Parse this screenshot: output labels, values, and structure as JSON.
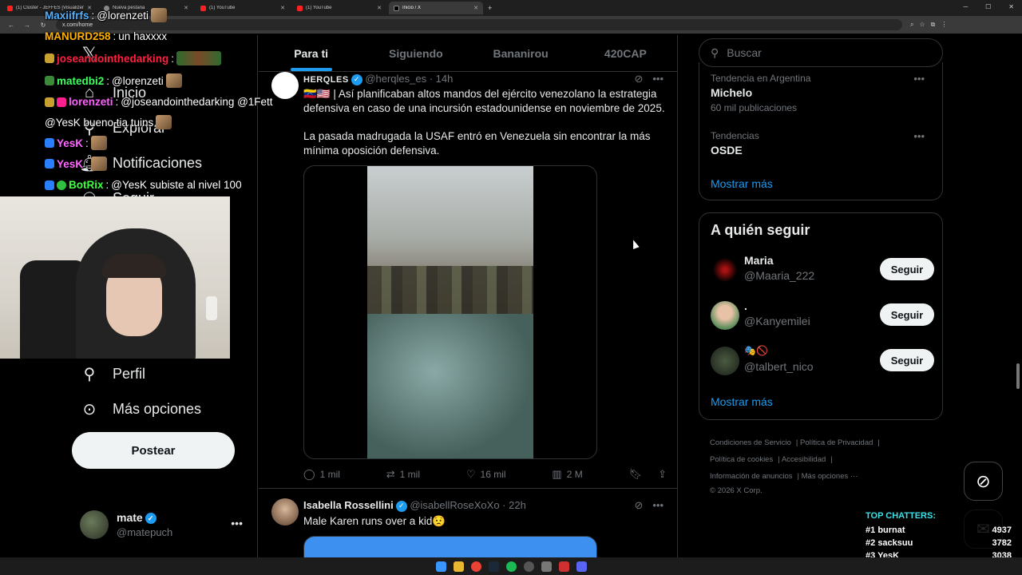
{
  "browser": {
    "tabs": [
      {
        "title": "(1) Clúster - JEFFES [Visualizer",
        "favicon": "youtube-icon",
        "active": false
      },
      {
        "title": "Nueva pestaña",
        "favicon": "chrome-icon",
        "active": false
      },
      {
        "title": "(1) YouTube",
        "favicon": "youtube-icon",
        "active": false
      },
      {
        "title": "(1) YouTube",
        "favicon": "youtube-icon",
        "active": false
      },
      {
        "title": "Inicio / X",
        "favicon": "x-icon",
        "active": true
      }
    ],
    "url": "x.com/home"
  },
  "chat_overlay": [
    {
      "user": "Maxiifrfs",
      "user_color": "#4fb0ff",
      "message": "@lorenzeti"
    },
    {
      "user": "MANURD258",
      "user_color": "#ffb000",
      "message": "un haxxxx"
    },
    {
      "user": "joseandointhedarking",
      "user_color": "#ff2040",
      "message": ""
    },
    {
      "user": "matedbi2",
      "user_color": "#40ff60",
      "message": "@lorenzeti"
    },
    {
      "user": "lorenzeti",
      "user_color": "#ff60ff",
      "message": "@joseandointhedarking @1Fett"
    },
    {
      "user": "",
      "user_color": "#ffffff",
      "message": "@YesK bueno tia tuins"
    },
    {
      "user": "YesK",
      "user_color": "#ff66ff",
      "message": ""
    },
    {
      "user": "YesK",
      "user_color": "#ff66ff",
      "message": ""
    },
    {
      "user": "BotRix",
      "user_color": "#40ff40",
      "message": "@YesK subiste al nivel 100"
    }
  ],
  "left_nav": {
    "items": [
      {
        "label": "Inicio",
        "icon": "home-icon"
      },
      {
        "label": "Explorar",
        "icon": "search-icon"
      },
      {
        "label": "Notificaciones",
        "icon": "bell-icon"
      },
      {
        "label": "Seguir",
        "icon": "follow-icon"
      },
      {
        "label": "Perfil",
        "icon": "person-icon"
      },
      {
        "label": "Más opciones",
        "icon": "more-circle-icon"
      }
    ],
    "post_button": "Postear",
    "account": {
      "name": "mate",
      "handle": "@matepuch"
    }
  },
  "feed": {
    "tabs": [
      "Para ti",
      "Siguiendo",
      "Bananirou",
      "420CAP"
    ],
    "active_tab": "Para ti",
    "tweets": [
      {
        "name": "HERQLES",
        "handle": "@herqles_es",
        "time": "· 14h",
        "text_1": "🇻🇪🇺🇸 | Así planificaban altos mandos del ejército venezolano la estrategia defensiva en caso de una incursión estadounidense en noviembre de 2025.",
        "text_2": "La pasada madrugada la USAF entró en Venezuela sin encontrar la más mínima oposición defensiva.",
        "replies": "1 mil",
        "reposts": "1 mil",
        "likes": "16 mil",
        "views": "2 M"
      },
      {
        "name": "Isabella Rossellini",
        "handle": "@isabellRoseXoXo",
        "time": "· 22h",
        "text_1": "Male Karen runs over a kid😟"
      }
    ]
  },
  "right_sidebar": {
    "search_placeholder": "Buscar",
    "trends": [
      {
        "meta": "Tendencia en Argentina",
        "title": "Michelo",
        "posts": "60 mil publicaciones"
      },
      {
        "meta": "Tendencias",
        "title": "OSDE",
        "posts": ""
      }
    ],
    "trends_more": "Mostrar más",
    "who_to_follow_title": "A quién seguir",
    "suggestions": [
      {
        "name": "Maria",
        "handle": "@Maaria_222",
        "button": "Seguir"
      },
      {
        "name": ".",
        "handle": "@Kanyemilei",
        "button": "Seguir"
      },
      {
        "name": "🎭🚫",
        "handle": "@talbert_nico",
        "button": "Seguir"
      }
    ],
    "follow_more": "Mostrar más",
    "footer_links": [
      "Condiciones de Servicio",
      "Política de Privacidad",
      "Política de cookies",
      "Accesibilidad",
      "Información de anuncios",
      "Más opciones ···"
    ],
    "copyright": "© 2026 X Corp."
  },
  "top_chatters": {
    "title": "TOP CHATTERS:",
    "rows": [
      {
        "rank": "#1",
        "name": "burnat",
        "count": "4937"
      },
      {
        "rank": "#2",
        "name": "sacksuu",
        "count": "3782"
      },
      {
        "rank": "#3",
        "name": "YesK",
        "count": "3038"
      }
    ]
  },
  "colors": {
    "accent": "#1d9bf0",
    "background": "#000000",
    "border": "#2f3336",
    "muted": "#71767b"
  }
}
